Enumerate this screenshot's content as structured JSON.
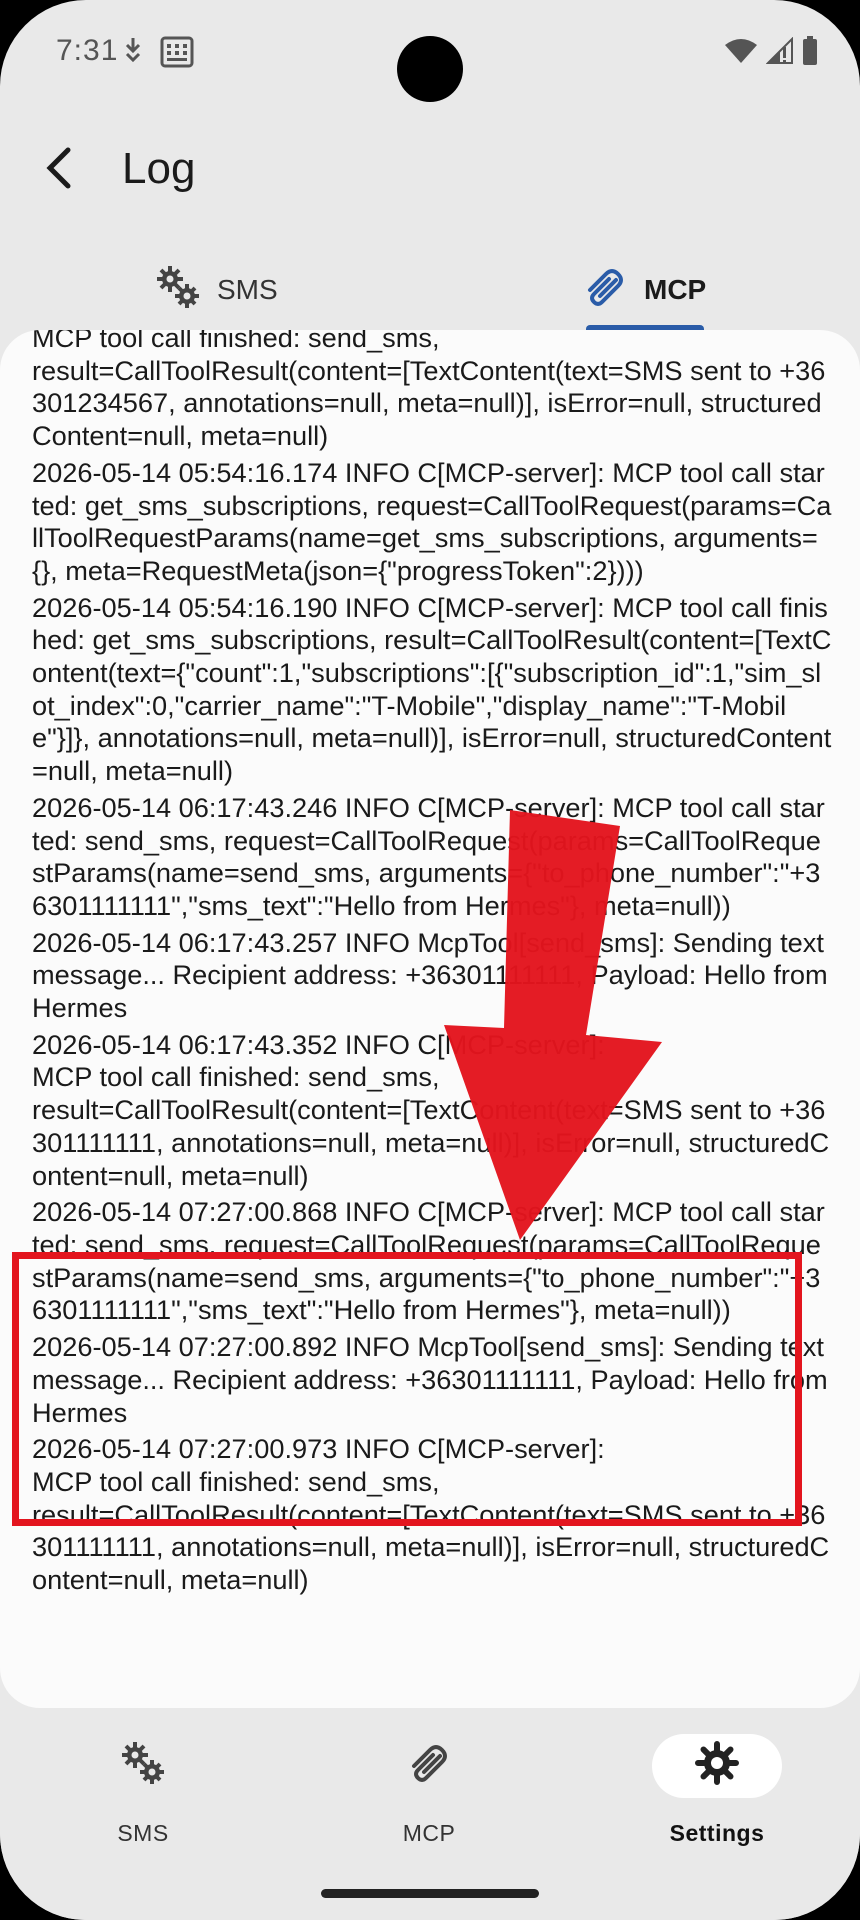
{
  "status_bar": {
    "time": "7:31",
    "icons": [
      "data-sync-icon",
      "sim-keyboard-icon",
      "wifi-icon",
      "signal-icon",
      "battery-icon"
    ]
  },
  "app_bar": {
    "title": "Log",
    "back_icon": "arrow-back-icon"
  },
  "tabs": [
    {
      "label": "SMS",
      "icon": "gears-icon",
      "selected": false
    },
    {
      "label": "MCP",
      "icon": "paperclip-icon",
      "selected": true
    }
  ],
  "log_entries": [
    "MCP tool call finished: send_sms,\nresult=CallToolResult(content=[TextContent(text=SMS sent to +36301234567, annotations=null, meta=null)], isError=null, structuredContent=null, meta=null)",
    "2026-05-14 05:54:16.174 INFO C[MCP-server]: MCP tool call started: get_sms_subscriptions, request=CallToolRequest(params=CallToolRequestParams(name=get_sms_subscriptions, arguments={}, meta=RequestMeta(json={\"progressToken\":2})))",
    "2026-05-14 05:54:16.190 INFO C[MCP-server]: MCP tool call finished: get_sms_subscriptions, result=CallToolResult(content=[TextContent(text={\"count\":1,\"subscriptions\":[{\"subscription_id\":1,\"sim_slot_index\":0,\"carrier_name\":\"T-Mobile\",\"display_name\":\"T-Mobile\"}]}, annotations=null, meta=null)], isError=null, structuredContent=null, meta=null)",
    "2026-05-14 06:17:43.246 INFO C[MCP-server]: MCP tool call started: send_sms, request=CallToolRequest(params=CallToolRequestParams(name=send_sms, arguments={\"to_phone_number\":\"+36301111111\",\"sms_text\":\"Hello from Hermes\"}, meta=null))",
    "2026-05-14 06:17:43.257 INFO McpTool[send_sms]: Sending text message... Recipient address: +36301111111, Payload: Hello from Hermes",
    "2026-05-14 06:17:43.352 INFO C[MCP-server]:\nMCP tool call finished: send_sms,\nresult=CallToolResult(content=[TextContent(text=SMS sent to +36301111111, annotations=null, meta=null)], isError=null, structuredContent=null, meta=null)",
    "2026-05-14 07:27:00.868 INFO C[MCP-server]: MCP tool call started: send_sms, request=CallToolRequest(params=CallToolRequestParams(name=send_sms, arguments={\"to_phone_number\":\"+36301111111\",\"sms_text\":\"Hello from Hermes\"}, meta=null))",
    "2026-05-14 07:27:00.892 INFO McpTool[send_sms]: Sending text message... Recipient address: +36301111111, Payload: Hello from Hermes",
    "2026-05-14 07:27:00.973 INFO C[MCP-server]:\nMCP tool call finished: send_sms,\nresult=CallToolResult(content=[TextContent(text=SMS sent to +36301111111, annotations=null, meta=null)], isError=null, structuredContent=null, meta=null)"
  ],
  "annotation": {
    "arrow_color": "#e3151e",
    "box_color": "#e3151e"
  },
  "bottom_nav": [
    {
      "label": "SMS",
      "icon": "gears-icon",
      "selected": false
    },
    {
      "label": "MCP",
      "icon": "paperclip-icon",
      "selected": false
    },
    {
      "label": "Settings",
      "icon": "gear-icon",
      "selected": true
    }
  ],
  "colors": {
    "accent": "#2a5ca8",
    "background": "#e9e9e9",
    "card": "#fbfbfb"
  }
}
